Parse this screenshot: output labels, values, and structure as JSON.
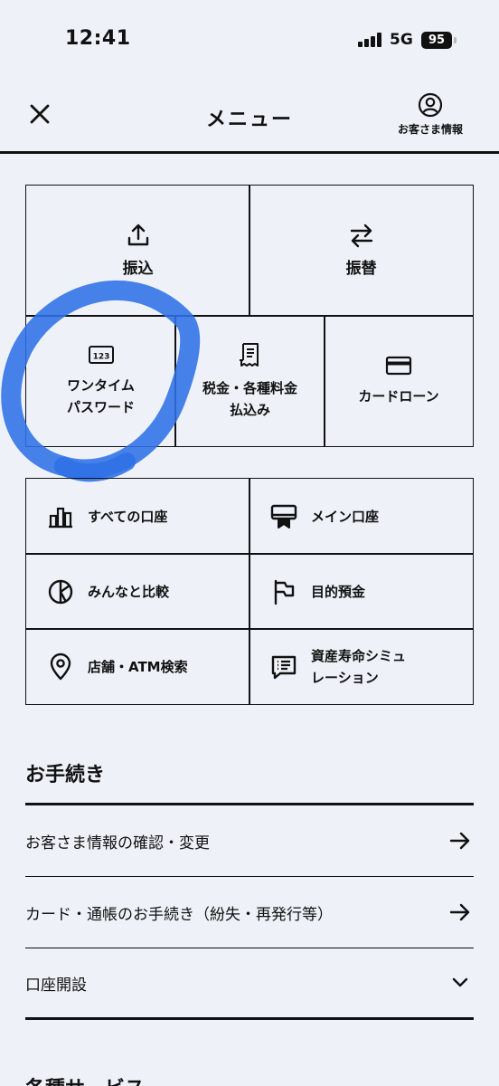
{
  "status_bar": {
    "time": "12:41",
    "network": "5G",
    "battery": "95"
  },
  "header": {
    "title": "メニュー",
    "customer_info_label": "お客さま情報"
  },
  "transfer_grid": [
    {
      "label": "振込",
      "icon": "upload-icon"
    },
    {
      "label": "振替",
      "icon": "swap-arrows-icon"
    }
  ],
  "service_grid": [
    {
      "label": "ワンタイム\nパスワード",
      "icon": "otp-123-icon"
    },
    {
      "label": "税金・各種料金\n払込み",
      "icon": "receipt-icon"
    },
    {
      "label": "カードローン",
      "icon": "credit-card-icon"
    }
  ],
  "account_menu": [
    {
      "label": "すべての口座",
      "icon": "bar-chart-icon"
    },
    {
      "label": "メイン口座",
      "icon": "main-account-icon"
    },
    {
      "label": "みんなと比較",
      "icon": "pie-compare-icon"
    },
    {
      "label": "目的預金",
      "icon": "flag-icon"
    },
    {
      "label": "店舗・ATM検索",
      "icon": "location-pin-icon"
    },
    {
      "label": "資産寿命シミュ\nレーション",
      "icon": "list-chat-icon"
    }
  ],
  "procedures": {
    "title": "お手続き",
    "items": [
      {
        "label": "お客さま情報の確認・変更",
        "action": "arrow-right-icon"
      },
      {
        "label": "カード・通帳のお手続き（紛失・再発行等）",
        "action": "arrow-right-icon"
      },
      {
        "label": "口座開設",
        "action": "chevron-down-icon"
      }
    ]
  },
  "next_section_title": "各種サービス",
  "colors": {
    "background": "#eef2f8",
    "text": "#111111",
    "highlight": "#2f6fe6"
  }
}
